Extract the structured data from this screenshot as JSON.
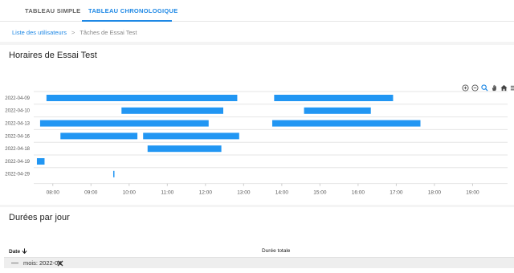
{
  "tabs": [
    {
      "label": "TABLEAU SIMPLE",
      "active": false
    },
    {
      "label": "TABLEAU CHRONOLOGIQUE",
      "active": true
    }
  ],
  "breadcrumb": {
    "parent": "Liste des utilisateurs",
    "separator": ">",
    "current": "Tâches de Essai Test"
  },
  "sections": {
    "schedule_title": "Horaires de Essai Test",
    "durations_title": "Durées par jour"
  },
  "toolbar": {
    "icons": [
      "zoom-in-icon",
      "zoom-out-icon",
      "zoom-select-icon",
      "pan-hand-icon",
      "home-icon",
      "menu-icon"
    ]
  },
  "chart_data": {
    "type": "bar",
    "orientation": "horizontal-timeline",
    "categories": [
      "2022-04-09",
      "2022-04-10",
      "2022-04-13",
      "2022-04-16",
      "2022-04-18",
      "2022-04-19",
      "2022-04-29"
    ],
    "x_ticks": [
      "08:00",
      "09:00",
      "10:00",
      "11:00",
      "12:00",
      "13:00",
      "14:00",
      "15:00",
      "16:00",
      "17:00",
      "18:00",
      "19:00"
    ],
    "xlim": [
      "07:30",
      "19:55"
    ],
    "color": "#2196f3",
    "series": [
      {
        "values": [
          {
            "category": "2022-04-09",
            "start": "07:50",
            "end": "12:50"
          },
          {
            "category": "2022-04-09",
            "start": "13:48",
            "end": "16:55"
          },
          {
            "category": "2022-04-10",
            "start": "09:48",
            "end": "12:28"
          },
          {
            "category": "2022-04-10",
            "start": "14:35",
            "end": "16:20"
          },
          {
            "category": "2022-04-13",
            "start": "07:40",
            "end": "12:05"
          },
          {
            "category": "2022-04-13",
            "start": "13:45",
            "end": "17:38"
          },
          {
            "category": "2022-04-16",
            "start": "08:12",
            "end": "10:13"
          },
          {
            "category": "2022-04-16",
            "start": "10:22",
            "end": "12:53"
          },
          {
            "category": "2022-04-18",
            "start": "10:29",
            "end": "12:25"
          },
          {
            "category": "2022-04-19",
            "start": "07:35",
            "end": "07:47"
          },
          {
            "category": "2022-04-29",
            "start": "09:35",
            "end": "09:36"
          }
        ]
      }
    ],
    "grid": true
  },
  "table": {
    "columns": [
      {
        "label": "Date",
        "sort": "desc"
      },
      {
        "label": "Durée totale"
      }
    ],
    "group": {
      "label": "mois: 2022-04"
    }
  }
}
